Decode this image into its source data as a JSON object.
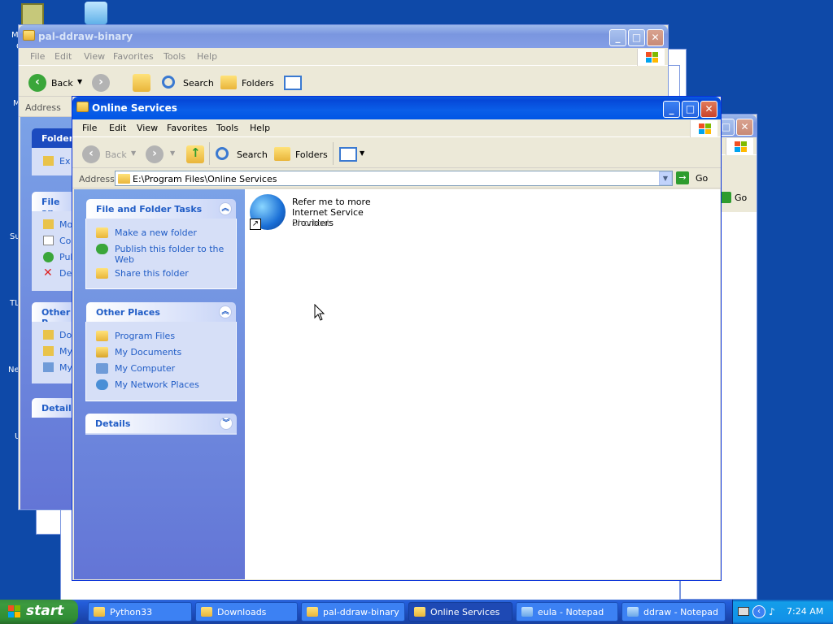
{
  "desktop": {
    "left_edge_labels": [
      "M",
      "C",
      "M",
      "Su",
      "TL",
      "Ne",
      "U"
    ]
  },
  "back_window": {
    "title": "pal-ddraw-binary",
    "menu": [
      "File",
      "Edit",
      "View",
      "Favorites",
      "Tools",
      "Help"
    ],
    "back_label": "Back",
    "search_label": "Search",
    "folders_label": "Folders",
    "address_label": "Address",
    "pane_headers": [
      "Folder",
      "File an",
      "Other P",
      "Details"
    ],
    "pane_items": [
      "Ex",
      "Mo",
      "Co",
      "Pul",
      "De",
      "Do",
      "My",
      "My"
    ]
  },
  "third_window": {
    "go_label": "Go"
  },
  "main_window": {
    "title": "Online Services",
    "menu": [
      "File",
      "Edit",
      "View",
      "Favorites",
      "Tools",
      "Help"
    ],
    "toolbar": {
      "back_label": "Back",
      "search_label": "Search",
      "folders_label": "Folders"
    },
    "address": {
      "label": "Address",
      "value": "E:\\Program Files\\Online Services",
      "go_label": "Go"
    },
    "tasks": {
      "title": "File and Folder Tasks",
      "items": [
        "Make a new folder",
        "Publish this folder to the Web",
        "Share this folder"
      ]
    },
    "other_places": {
      "title": "Other Places",
      "items": [
        "Program Files",
        "My Documents",
        "My Computer",
        "My Network Places"
      ]
    },
    "details": {
      "title": "Details"
    },
    "file": {
      "name": "Refer me to more Internet Service Providers",
      "type": "Shortcut"
    }
  },
  "taskbar": {
    "start_label": "start",
    "buttons": [
      "Python33",
      "Downloads",
      "pal-ddraw-binary",
      "Online Services",
      "eula - Notepad",
      "ddraw - Notepad"
    ],
    "active_index": 3,
    "clock": "7:24 AM"
  },
  "colors": {
    "desktop": "#0e49a8",
    "titlebar_active": "#0a5ee8",
    "task_link": "#215dc6"
  }
}
